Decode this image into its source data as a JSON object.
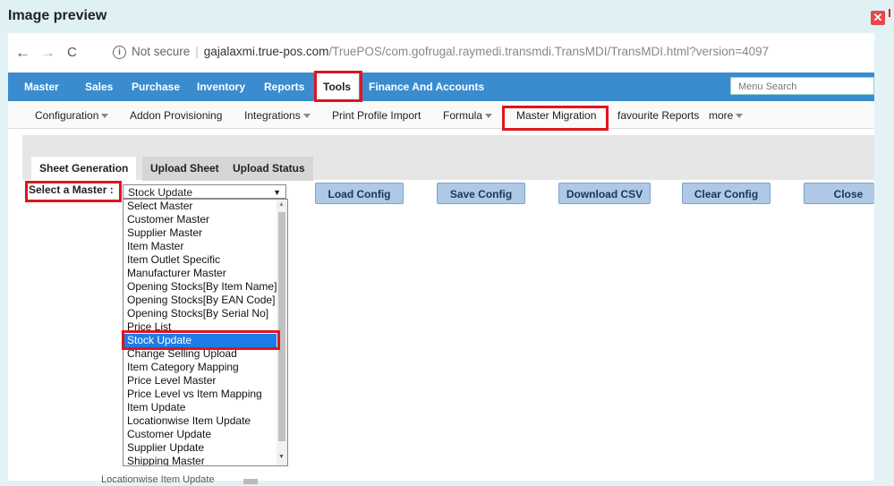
{
  "dialog": {
    "title": "Image preview",
    "close_glyph": "✕"
  },
  "browser": {
    "back": "←",
    "forward": "→",
    "reload": "C",
    "info": "i",
    "not_secure": "Not secure",
    "domain": "gajalaxmi.true-pos.com",
    "path": "/TruePOS/com.gofrugal.raymedi.transmdi.TransMDI/TransMDI.html?version=4097"
  },
  "menu": {
    "items": [
      "Master",
      "Sales",
      "Purchase",
      "Inventory",
      "Reports",
      "Tools",
      "Finance And Accounts"
    ],
    "active": "Tools",
    "search_placeholder": "Menu Search"
  },
  "submenu": {
    "items": [
      "Configuration",
      "Addon Provisioning",
      "Integrations",
      "Print Profile Import",
      "Formula",
      "Master Migration",
      "favourite Reports",
      "more"
    ]
  },
  "tabs": [
    "Sheet Generation",
    "Upload Sheet",
    "Upload Status"
  ],
  "form": {
    "label": "Select a Master :",
    "selected": "Stock Update",
    "buttons": [
      "Load Config",
      "Save Config",
      "Download CSV",
      "Clear Config",
      "Close"
    ]
  },
  "options": [
    "Select Master",
    "Customer Master",
    "Supplier Master",
    "Item Master",
    "Item Outlet Specific",
    "Manufacturer Master",
    "Opening Stocks[By Item Name]",
    "Opening Stocks[By EAN Code]",
    "Opening Stocks[By Serial No]",
    "Price List",
    "Stock Update",
    "Change Selling Upload",
    "Item Category Mapping",
    "Price Level Master",
    "Price Level vs Item Mapping",
    "Item Update",
    "Locationwise Item Update",
    "Customer Update",
    "Supplier Update",
    "Shipping Master"
  ],
  "background_text": "Locationwise Item Update",
  "colors": {
    "menu_bar": "#3a8ccf",
    "highlight": "#e0141e",
    "selection": "#1e7ce6",
    "button": "#aec8e6"
  }
}
